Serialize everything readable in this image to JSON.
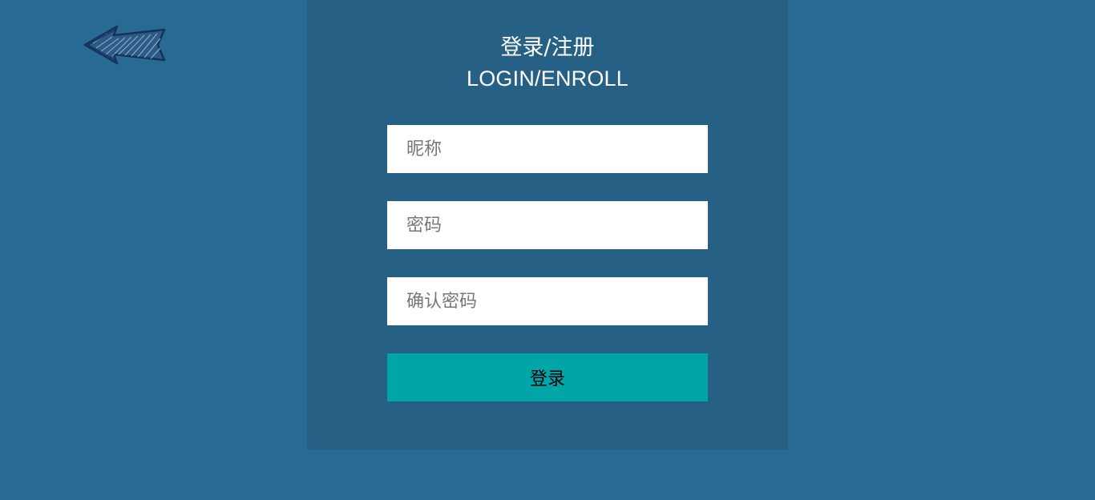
{
  "header": {
    "title_zh": "登录/注册",
    "title_en": "LOGIN/ENROLL"
  },
  "nav": {
    "back_icon": "back-arrow-icon"
  },
  "form": {
    "nickname": {
      "value": "",
      "placeholder": "昵称"
    },
    "password": {
      "value": "",
      "placeholder": "密码"
    },
    "confirm_password": {
      "value": "",
      "placeholder": "确认密码"
    },
    "submit_label": "登录"
  },
  "colors": {
    "background": "#286a94",
    "panel": "#266185",
    "button": "#00a5a8",
    "arrow": "#1c3d63"
  }
}
